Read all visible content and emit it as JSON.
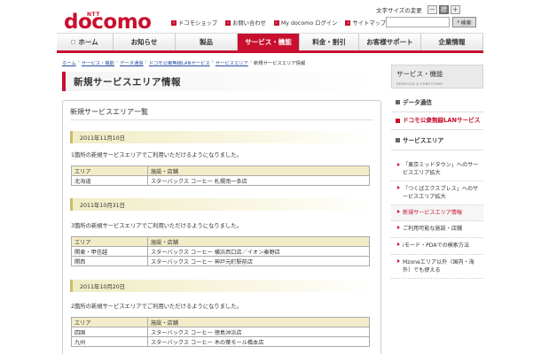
{
  "header": {
    "ntt": "NTT",
    "logo": "docomo",
    "font_size_label": "文字サイズの変更",
    "font_buttons": [
      "－",
      "標",
      "＋"
    ],
    "links": [
      {
        "icon": "i",
        "label": "ドコモショップ"
      },
      {
        "icon": "i",
        "label": "お問い合わせ"
      },
      {
        "icon": "i",
        "label": "My docomo ログイン"
      },
      {
        "icon": "i",
        "label": "サイトマップ"
      }
    ],
    "search_placeholder": "",
    "search_label": "検索"
  },
  "nav": {
    "items": [
      {
        "label": "ホーム"
      },
      {
        "label": "お知らせ"
      },
      {
        "label": "製品"
      },
      {
        "label": "サービス・機能"
      },
      {
        "label": "料金・割引"
      },
      {
        "label": "お客様サポート"
      },
      {
        "label": "企業情報"
      }
    ]
  },
  "breadcrumb": [
    "ホーム",
    "サービス・機能",
    "データ通信",
    "ドコモ公衆無線LANサービス",
    "サービスエリア",
    "新規サービスエリア情報"
  ],
  "page_title": "新規サービスエリア情報",
  "content": {
    "section_title": "新規サービスエリア一覧",
    "col_area": "エリア",
    "col_facility": "施設・店舗",
    "groups": [
      {
        "date": "2011年11月10日",
        "desc": "1箇所の新規サービスエリアでご利用いただけるようになりました。",
        "rows": [
          [
            "北海道",
            "スターバックス コーヒー 札幌南一条店"
          ]
        ]
      },
      {
        "date": "2011年10月31日",
        "desc": "3箇所の新規サービスエリアでご利用いただけるようになりました。",
        "rows": [
          [
            "関東・甲信越",
            "スターバックス コーヒー 横浜西口店／イオン秦野店"
          ],
          [
            "関西",
            "スターバックス コーヒー 神戸元町駅前店"
          ]
        ]
      },
      {
        "date": "2011年10月20日",
        "desc": "2箇所の新規サービスエリアでご利用いただけるようになりました。",
        "rows": [
          [
            "四国",
            "スターバックス コーヒー 徳島沖浜店"
          ],
          [
            "九州",
            "スターバックス コーヒー 木の葉モール橋本店"
          ]
        ]
      }
    ]
  },
  "sidebar": {
    "title": "サービス・機能",
    "subtitle": "SERVICES & FUNCTIONS",
    "cat1": "データ通信",
    "cat2": "ドコモ公衆無線LANサービス",
    "cat3": "サービスエリア",
    "items": [
      {
        "label": "「東京ミッドタウン」へのサービスエリア拡大"
      },
      {
        "label": "「つくばエクスプレス」へのサービスエリア拡大"
      },
      {
        "label": "新規サービスエリア情報"
      },
      {
        "label": "ご利用可能な施設・店舗"
      },
      {
        "label": "iモード・PDAでの検索方法"
      },
      {
        "label": "Mzoneエリア以外（国内・海外）でも使える"
      }
    ]
  }
}
